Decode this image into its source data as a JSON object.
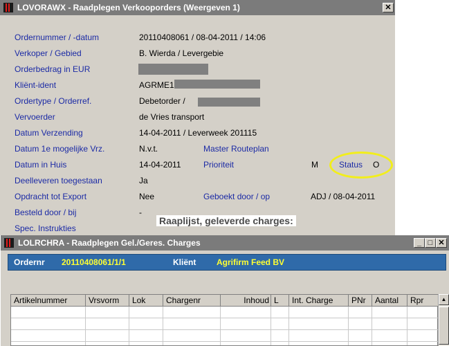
{
  "window1": {
    "title": "LOVORAWX - Raadplegen Verkooporders (Weergeven 1)",
    "close_glyph": "✕",
    "fields": [
      {
        "label": "Ordernummer / -datum",
        "value": "20110408061 / 08-04-2011 / 14:06"
      },
      {
        "label": "Verkoper / Gebied",
        "value": "B. Wierda / Levergebie"
      },
      {
        "label": "Orderbedrag in EUR",
        "value": ""
      },
      {
        "label": "Kliënt-ident",
        "value": "AGRME1"
      },
      {
        "label": "Ordertype / Orderref.",
        "value": "Debetorder /"
      },
      {
        "label": "Vervoerder",
        "value": "de Vries transport"
      },
      {
        "label": "Datum Verzending",
        "value": "14-04-2011 / Leverweek 201115"
      },
      {
        "label": "Datum 1e mogelijke Vrz.",
        "value": "N.v.t."
      },
      {
        "label": "Datum in Huis",
        "value": "14-04-2011"
      },
      {
        "label": "Deelleveren toegestaan",
        "value": "Ja"
      },
      {
        "label": "Opdracht tot Export",
        "value": "Nee"
      },
      {
        "label": "Besteld door / bij",
        "value": "-"
      },
      {
        "label": "Spec. Instrukties",
        "value": ""
      }
    ],
    "right_fields": {
      "master_routeplan": {
        "label": "Master Routeplan"
      },
      "prioriteit": {
        "label": "Prioriteit",
        "value": "M"
      },
      "status": {
        "label": "Status",
        "value": "O"
      },
      "geboekt": {
        "label": "Geboekt door / op",
        "value": "ADJ / 08-04-2011"
      }
    }
  },
  "caption": "Raaplijst, geleverde charges:",
  "window2": {
    "title": "LOLRCHRA - Raadplegen Gel./Geres. Charges",
    "buttons": {
      "minimize": "_",
      "maximize": "□",
      "close": "✕"
    },
    "header": {
      "ordernr_label": "Ordernr",
      "ordernr_value": "20110408061/1/1",
      "klient_label": "Kliënt",
      "klient_value": "Agrifirm Feed BV"
    },
    "grid": {
      "columns": [
        "Artikelnummer",
        "Vrsvorm",
        "Lok",
        "Chargenr",
        "Inhoud",
        "L",
        "Int. Charge",
        "PNr",
        "Aantal",
        "Rpr"
      ],
      "rows": []
    },
    "scroll_up_glyph": "▲"
  },
  "colors": {
    "window_bg": "#d4d0c8",
    "label_blue": "#1b2aa5",
    "header_panel": "#2f6aa9",
    "header_value": "#ffff33",
    "highlight_ring": "#f2ee1c"
  }
}
